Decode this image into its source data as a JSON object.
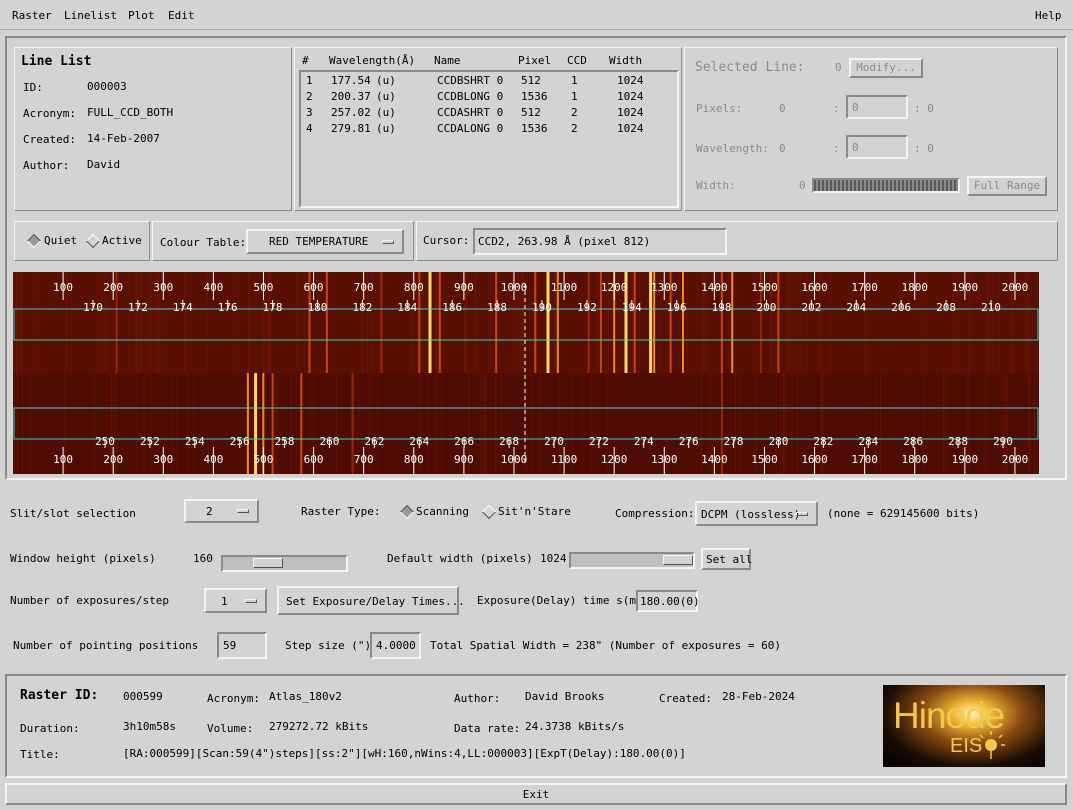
{
  "menu": {
    "raster": "Raster",
    "linelist": "Linelist",
    "plot": "Plot",
    "edit": "Edit",
    "help": "Help"
  },
  "line_list": {
    "title": "Line List",
    "id_label": "ID:",
    "id": "000003",
    "acronym_label": "Acronym:",
    "acronym": "FULL_CCD_BOTH",
    "created_label": "Created:",
    "created": "14-Feb-2007",
    "author_label": "Author:",
    "author": "David"
  },
  "lines_table": {
    "headers": [
      "#",
      "Wavelength(Å)",
      "Name",
      "Pixel",
      "CCD",
      "Width"
    ],
    "rows": [
      [
        "1",
        "177.54",
        "(u)",
        "CCDBSHRT 0",
        "512",
        "1",
        "1024"
      ],
      [
        "2",
        "200.37",
        "(u)",
        "CCDBLONG 0",
        "1536",
        "1",
        "1024"
      ],
      [
        "3",
        "257.02",
        "(u)",
        "CCDASHRT 0",
        "512",
        "2",
        "1024"
      ],
      [
        "4",
        "279.81",
        "(u)",
        "CCDALONG 0",
        "1536",
        "2",
        "1024"
      ]
    ]
  },
  "selected_line": {
    "label": "Selected Line:",
    "value": "0",
    "modify": "Modify...",
    "pixels_label": "Pixels:",
    "pixels_value": "0",
    "pixels_sep": ":",
    "pixels_input": "0",
    "pixels_end": ": 0",
    "wavelength_label": "Wavelength:",
    "wavelength_value": "0",
    "wavelength_sep": ":",
    "wavelength_input": "0",
    "wavelength_end": ": 0",
    "width_label": "Width:",
    "width_value": "0",
    "full_range": "Full Range"
  },
  "display": {
    "quiet": "Quiet",
    "active": "Active",
    "colour_table_label": "Colour Table:",
    "colour_table": "RED TEMPERATURE",
    "cursor_label": "Cursor:",
    "cursor_value": "CCD2, 263.98 Å (pixel 812)"
  },
  "spectrum": {
    "pixel_ticks": [
      "100",
      "200",
      "300",
      "400",
      "500",
      "600",
      "700",
      "800",
      "900",
      "1000",
      "1100",
      "1200",
      "1300",
      "1400",
      "1500",
      "1600",
      "1700",
      "1800",
      "1900",
      "2000"
    ],
    "ccd1_wavelength_ticks": [
      "170",
      "172",
      "174",
      "176",
      "178",
      "180",
      "182",
      "184",
      "186",
      "188",
      "190",
      "192",
      "194",
      "196",
      "198",
      "200",
      "202",
      "204",
      "206",
      "208",
      "210"
    ],
    "ccd2_wavelength_ticks": [
      "250",
      "252",
      "254",
      "256",
      "258",
      "260",
      "262",
      "264",
      "266",
      "268",
      "270",
      "272",
      "274",
      "276",
      "278",
      "280",
      "282",
      "284",
      "286",
      "288",
      "290"
    ],
    "bright_lines_ccd1": [
      {
        "x": 0.395,
        "i": 0.55
      },
      {
        "x": 0.405,
        "i": 0.95
      },
      {
        "x": 0.415,
        "i": 0.4
      },
      {
        "x": 0.47,
        "i": 0.45
      },
      {
        "x": 0.508,
        "i": 0.5
      },
      {
        "x": 0.52,
        "i": 0.9
      },
      {
        "x": 0.53,
        "i": 0.6
      },
      {
        "x": 0.56,
        "i": 0.35
      },
      {
        "x": 0.572,
        "i": 0.45
      },
      {
        "x": 0.585,
        "i": 0.6
      },
      {
        "x": 0.596,
        "i": 0.85
      },
      {
        "x": 0.605,
        "i": 0.5
      },
      {
        "x": 0.62,
        "i": 0.9
      },
      {
        "x": 0.624,
        "i": 0.8
      },
      {
        "x": 0.64,
        "i": 0.5
      },
      {
        "x": 0.652,
        "i": 0.7
      },
      {
        "x": 0.69,
        "i": 0.45
      },
      {
        "x": 0.7,
        "i": 0.6
      },
      {
        "x": 0.728,
        "i": 0.3
      },
      {
        "x": 0.745,
        "i": 0.4
      },
      {
        "x": 0.288,
        "i": 0.55
      },
      {
        "x": 0.305,
        "i": 0.5
      },
      {
        "x": 0.358,
        "i": 0.35
      },
      {
        "x": 0.1,
        "i": 0.3
      }
    ],
    "bright_lines_ccd2": [
      {
        "x": 0.228,
        "i": 0.6
      },
      {
        "x": 0.235,
        "i": 0.95
      },
      {
        "x": 0.243,
        "i": 0.75
      },
      {
        "x": 0.252,
        "i": 0.5
      },
      {
        "x": 0.28,
        "i": 0.4
      },
      {
        "x": 0.33,
        "i": 0.35
      },
      {
        "x": 0.69,
        "i": 0.3
      }
    ]
  },
  "controls": {
    "slit_label": "Slit/slot selection",
    "slit_value": "2",
    "raster_type_label": "Raster Type:",
    "scanning": "Scanning",
    "sit_n_stare": "Sit'n'Stare",
    "compression_label": "Compression:",
    "compression_value": "DCPM (lossless)",
    "compression_info": "(none = 629145600 bits)",
    "window_height_label": "Window height (pixels)",
    "window_height_value": "160",
    "default_width_label": "Default width (pixels)",
    "default_width_value": "1024",
    "set_all": "Set all",
    "exposures_label": "Number of exposures/step",
    "exposures_value": "1",
    "set_exposure": "Set Exposure/Delay Times...",
    "exposure_time_label": "Exposure(Delay) time s(ms)",
    "exposure_time_value": "180.00(0)",
    "pointing_label": "Number of pointing positions",
    "pointing_value": "59",
    "step_size_label": "Step size (\")",
    "step_size_value": "4.0000",
    "total_width": "Total Spatial Width = 238\" (Number of exposures = 60)"
  },
  "raster_info": {
    "raster_id_label": "Raster ID:",
    "raster_id": "000599",
    "acronym_label": "Acronym:",
    "acronym": "Atlas_180v2",
    "author_label": "Author:",
    "author": "David Brooks",
    "created_label": "Created:",
    "created": "28-Feb-2024",
    "duration_label": "Duration:",
    "duration": "3h10m58s",
    "volume_label": "Volume:",
    "volume": "279272.72 kBits",
    "data_rate_label": "Data rate:",
    "data_rate": "24.3738 kBits/s",
    "title_label": "Title:",
    "title": "[RA:000599][Scan:59(4\")steps][ss:2\"][wH:160,nWins:4,LL:000003][ExpT(Delay):180.00(0)]"
  },
  "logo": {
    "line1": "Hinode",
    "line2": "EIS"
  },
  "exit": "Exit"
}
